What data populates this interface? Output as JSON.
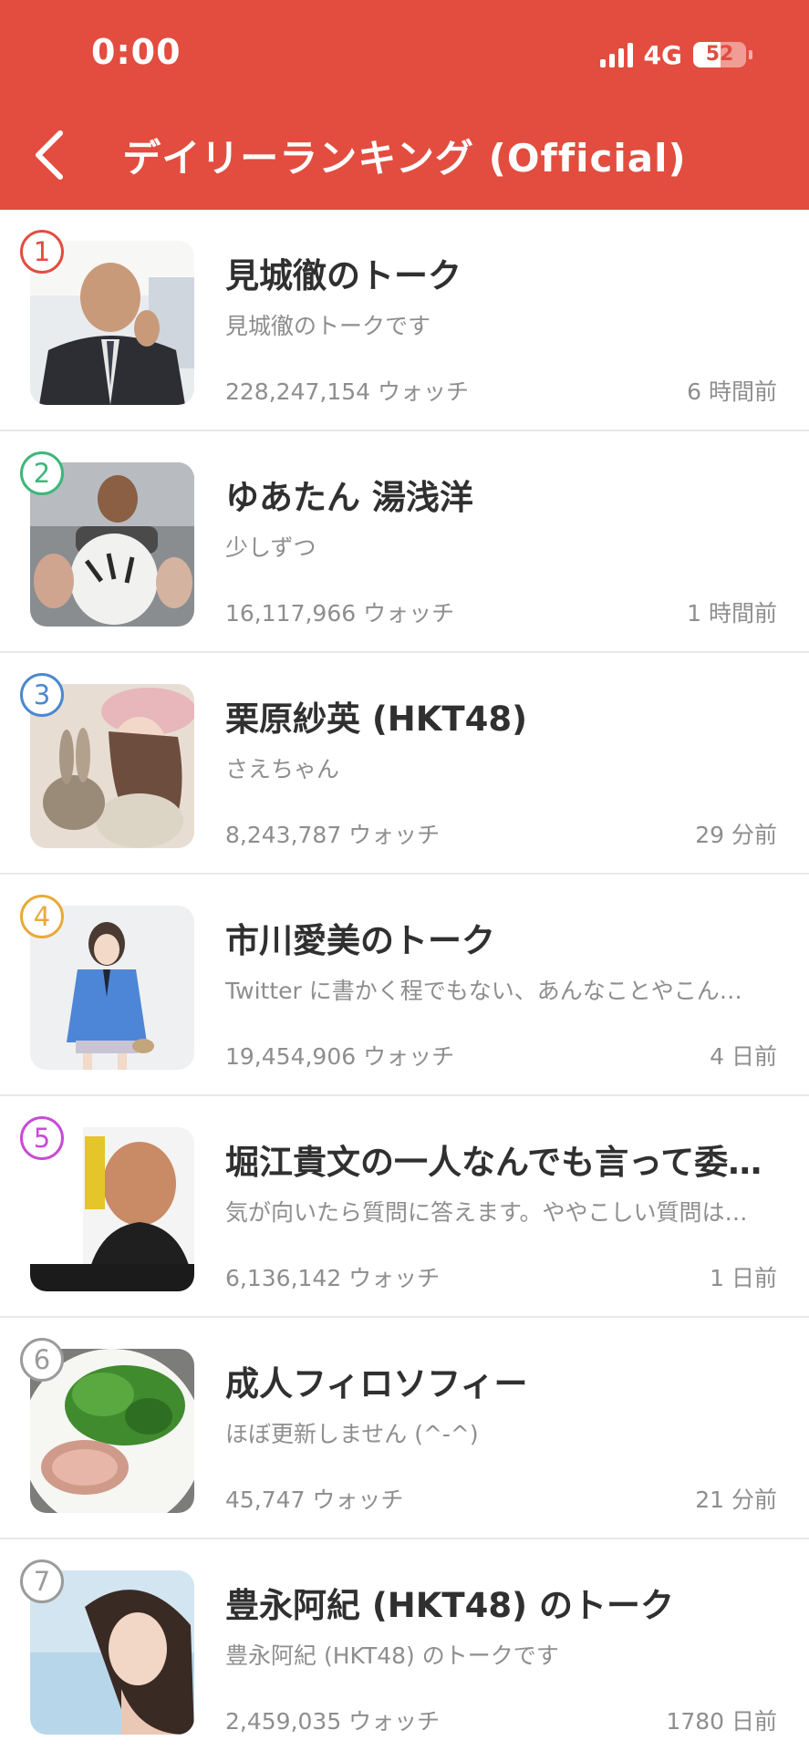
{
  "status_bar": {
    "time": "0:00",
    "network": "4G",
    "battery": "52",
    "battery_level": 0.52
  },
  "header": {
    "title": "デイリーランキング (Official)",
    "back_icon": "chevron-left-icon",
    "background_color": "#e24d3f"
  },
  "rankings": [
    {
      "rank": "1",
      "badge_color": "#e24d3f",
      "title": "見城徹のトーク",
      "subtitle": "見城徹のトークです",
      "watch": "228,247,154 ウォッチ",
      "time": "6 時間前"
    },
    {
      "rank": "2",
      "badge_color": "#3db67a",
      "title": "ゆあたん 湯浅洋",
      "subtitle": "少しずつ",
      "watch": "16,117,966 ウォッチ",
      "time": "1 時間前"
    },
    {
      "rank": "3",
      "badge_color": "#4b88cf",
      "title": "栗原紗英 (HKT48)",
      "subtitle": "さえちゃん",
      "watch": "8,243,787 ウォッチ",
      "time": "29 分前"
    },
    {
      "rank": "4",
      "badge_color": "#e9a93a",
      "title": "市川愛美のトーク",
      "subtitle": "Twitter に書かく程でもない、あんなことやこん…",
      "watch": "19,454,906 ウォッチ",
      "time": "4 日前"
    },
    {
      "rank": "5",
      "badge_color": "#c84bd6",
      "title": "堀江貴文の一人なんでも言って委…",
      "subtitle": "気が向いたら質問に答えます。ややこしい質問は…",
      "watch": "6,136,142 ウォッチ",
      "time": "1 日前"
    },
    {
      "rank": "6",
      "badge_color": "#9b9b9b",
      "title": "成人フィロソフィー",
      "subtitle": "ほぼ更新しません (^-^)",
      "watch": "45,747 ウォッチ",
      "time": "21 分前"
    },
    {
      "rank": "7",
      "badge_color": "#9b9b9b",
      "title": "豊永阿紀 (HKT48) のトーク",
      "subtitle": "豊永阿紀 (HKT48) のトークです",
      "watch": "2,459,035 ウォッチ",
      "time": "1780 日前"
    }
  ]
}
